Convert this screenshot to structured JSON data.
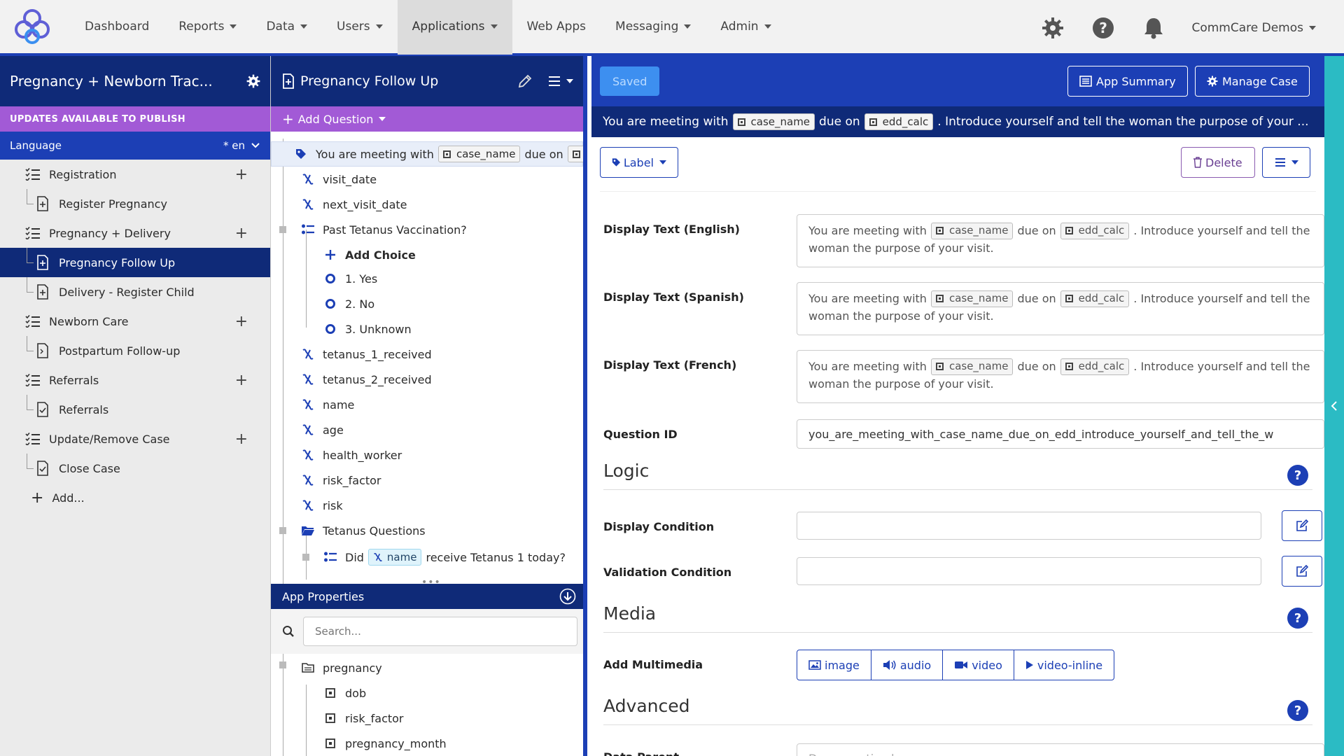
{
  "nav": {
    "items": [
      {
        "label": "Dashboard",
        "caret": false
      },
      {
        "label": "Reports",
        "caret": true
      },
      {
        "label": "Data",
        "caret": true
      },
      {
        "label": "Users",
        "caret": true
      },
      {
        "label": "Applications",
        "caret": true
      },
      {
        "label": "Web Apps",
        "caret": false
      },
      {
        "label": "Messaging",
        "caret": true
      },
      {
        "label": "Admin",
        "caret": true
      }
    ],
    "active": "Applications",
    "user": "CommCare Demos"
  },
  "sidebar": {
    "title": "Pregnancy + Newborn Trac...",
    "updates": "UPDATES AVAILABLE TO PUBLISH",
    "language_label": "Language",
    "language_value": "* en",
    "modules": [
      {
        "label": "Registration",
        "forms": [
          "Register Pregnancy"
        ]
      },
      {
        "label": "Pregnancy + Delivery",
        "forms": [
          "Pregnancy Follow Up",
          "Delivery - Register Child"
        ]
      },
      {
        "label": "Newborn Care",
        "forms": [
          "Postpartum Follow-up"
        ]
      },
      {
        "label": "Referrals",
        "forms": [
          "Referrals"
        ]
      },
      {
        "label": "Update/Remove Case",
        "forms": [
          "Close Case"
        ]
      }
    ],
    "add_label": "Add..."
  },
  "form": {
    "title": "Pregnancy Follow Up",
    "add_question": "Add Question",
    "selected_q": {
      "pre": "You are meeting with",
      "chip1": "case_name",
      "mid": "due on"
    },
    "questions": {
      "visit_date": "visit_date",
      "next_visit_date": "next_visit_date",
      "tetanus": "Past Tetanus Vaccination?",
      "add_choice": "Add Choice",
      "choice1": "1. Yes",
      "choice2": "2. No",
      "choice3": "3. Unknown",
      "t1": "tetanus_1_received",
      "t2": "tetanus_2_received",
      "name": "name",
      "age": "age",
      "health_worker": "health_worker",
      "risk_factor": "risk_factor",
      "risk": "risk",
      "group": "Tetanus Questions",
      "did": "Did",
      "did_chip": "name",
      "did_post": "receive Tetanus 1 today?"
    },
    "app_properties": "App Properties",
    "search_placeholder": "Search...",
    "properties": {
      "group": "pregnancy",
      "dob": "dob",
      "risk_factor": "risk_factor",
      "pregnancy_month": "pregnancy_month"
    }
  },
  "editor": {
    "saved": "Saved",
    "app_summary": "App Summary",
    "manage_case": "Manage Case",
    "qbar": {
      "pre": "You are meeting with",
      "chip1": "case_name",
      "mid": "due on",
      "chip2": "edd_calc",
      "post": ". Introduce yourself and tell the woman the purpose of your ..."
    },
    "label_btn": "Label",
    "delete_btn": "Delete",
    "display_text": {
      "pre": "You are meeting with",
      "chip1": "case_name",
      "mid": "due on",
      "chip2": "edd_calc",
      "post": ". Introduce yourself and tell the",
      "line2": "woman the purpose of your visit."
    },
    "labels": {
      "english": "Display Text (English)",
      "spanish": "Display Text (Spanish)",
      "french": "Display Text (French)",
      "qid": "Question ID",
      "display_condition": "Display Condition",
      "validation_condition": "Validation Condition",
      "add_multimedia": "Add Multimedia",
      "data_parent": "Data Parent"
    },
    "qid_value": "you_are_meeting_with_case_name_due_on_edd_introduce_yourself_and_tell_the_w",
    "sections": {
      "logic": "Logic",
      "media": "Media",
      "advanced": "Advanced"
    },
    "media_buttons": [
      "image",
      "audio",
      "video",
      "video-inline"
    ],
    "data_parent_placeholder": "Drag question here"
  },
  "colors": {
    "nav_blue": "#1c3fb5",
    "dark_navy": "#0f2a78",
    "purple": "#a25ad6",
    "teal": "#2bbbc4"
  }
}
